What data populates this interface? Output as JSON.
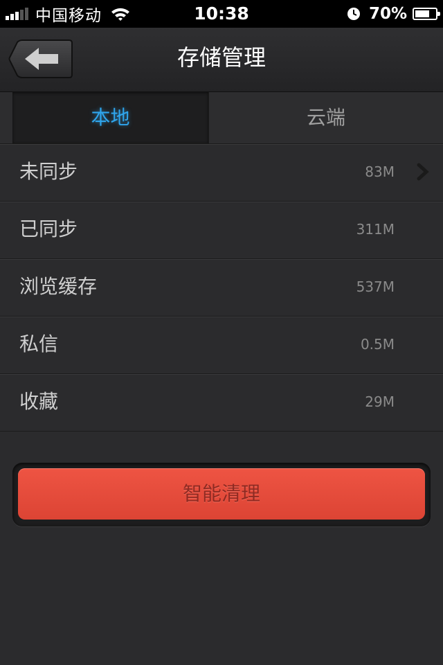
{
  "status_bar": {
    "carrier": "中国移动",
    "time": "10:38",
    "battery_percent": "70%",
    "battery_level": 0.7
  },
  "nav": {
    "title": "存储管理",
    "back_icon": "back-arrow-icon"
  },
  "tabs": [
    {
      "label": "本地",
      "active": true
    },
    {
      "label": "云端",
      "active": false
    }
  ],
  "list": {
    "items": [
      {
        "label": "未同步",
        "size": "83M",
        "has_chevron": true
      },
      {
        "label": "已同步",
        "size": "311M",
        "has_chevron": false
      },
      {
        "label": "浏览缓存",
        "size": "537M",
        "has_chevron": false
      },
      {
        "label": "私信",
        "size": "0.5M",
        "has_chevron": false
      },
      {
        "label": "收藏",
        "size": "29M",
        "has_chevron": false
      }
    ]
  },
  "actions": {
    "clean_label": "智能清理"
  },
  "colors": {
    "accent_blue": "#2fa6ee",
    "button_red": "#e44a3a",
    "background": "#2b2b2d"
  }
}
